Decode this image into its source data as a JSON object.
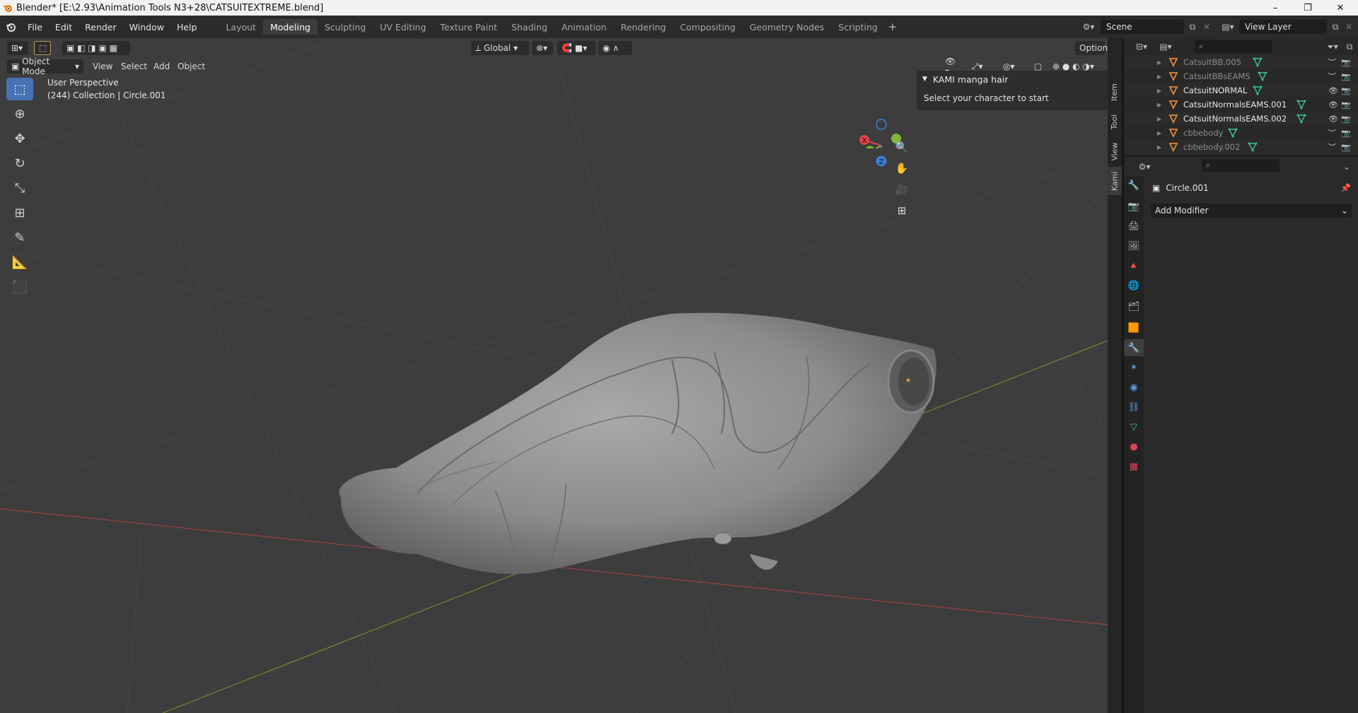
{
  "window": {
    "title": "Blender* [E:\\2.93\\Animation Tools N3+28\\CATSUITEXTREME.blend]",
    "controls": [
      "–",
      "❐",
      "✕"
    ]
  },
  "menu": [
    "File",
    "Edit",
    "Render",
    "Window",
    "Help"
  ],
  "workspaces": [
    {
      "label": "Layout",
      "active": false
    },
    {
      "label": "Modeling",
      "active": true
    },
    {
      "label": "Sculpting",
      "active": false
    },
    {
      "label": "UV Editing",
      "active": false
    },
    {
      "label": "Texture Paint",
      "active": false
    },
    {
      "label": "Shading",
      "active": false
    },
    {
      "label": "Animation",
      "active": false
    },
    {
      "label": "Rendering",
      "active": false
    },
    {
      "label": "Compositing",
      "active": false
    },
    {
      "label": "Geometry Nodes",
      "active": false
    },
    {
      "label": "Scripting",
      "active": false
    }
  ],
  "scene": {
    "label": "Scene"
  },
  "view_layer": {
    "label": "View Layer"
  },
  "viewport_header": {
    "transform_orientation": "Global",
    "options_label": "Options",
    "mode": "Object Mode",
    "menus": [
      "View",
      "Select",
      "Add",
      "Object"
    ]
  },
  "viewport_info": {
    "perspective": "User Perspective",
    "collection": "(244) Collection | Circle.001"
  },
  "gizmo_axes": {
    "x": "X",
    "y": "Y",
    "z": "Z"
  },
  "npanel": {
    "panel_title": "KAMI manga hair",
    "panel_text": "Select your character to start",
    "tabs": [
      "Item",
      "Tool",
      "View",
      "Kami"
    ]
  },
  "outliner": {
    "rows": [
      {
        "name": "CatsuitBB.005",
        "dim": true,
        "visible": false
      },
      {
        "name": "CatsuitBBsEAMS",
        "dim": true,
        "visible": false
      },
      {
        "name": "CatsuitNORMAL",
        "dim": false,
        "visible": true
      },
      {
        "name": "CatsuitNormalsEAMS.001",
        "dim": false,
        "visible": true
      },
      {
        "name": "CatsuitNormalsEAMS.002",
        "dim": false,
        "visible": true
      },
      {
        "name": "cbbebody",
        "dim": true,
        "visible": false
      },
      {
        "name": "cbbebody.002",
        "dim": true,
        "visible": false
      }
    ]
  },
  "properties": {
    "object_name": "Circle.001",
    "add_modifier_label": "Add Modifier"
  },
  "colors": {
    "accent": "#4772b3",
    "mesh_tri": "#e08a38",
    "mesh_data": "#39c38f",
    "axis_x": "#e0424a",
    "axis_y": "#7fb83a",
    "axis_z": "#3a7ed6"
  }
}
